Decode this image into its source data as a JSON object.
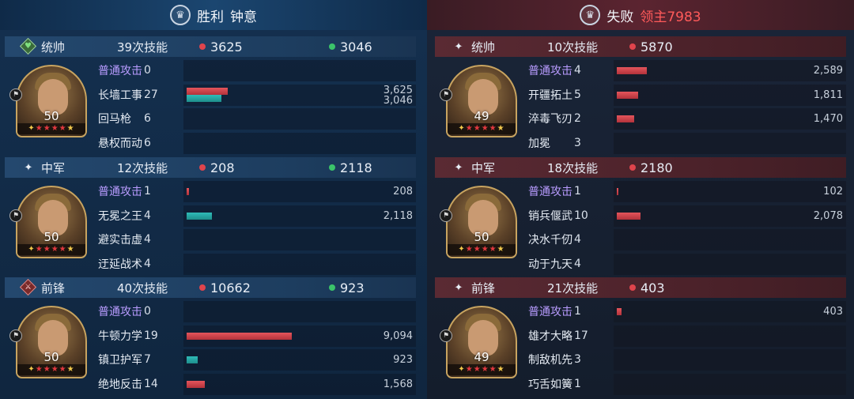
{
  "left": {
    "result": "胜利",
    "player": "钟意",
    "sections": [
      {
        "role": "统帅",
        "role_icon": "heart-icon",
        "casts": "39次技能",
        "damage": "3625",
        "heal": "3046",
        "level": "50",
        "skills": [
          {
            "name": "普通攻击",
            "count": "0",
            "basic": true
          },
          {
            "name": "长墙工事",
            "count": "27",
            "dmg": "3,625",
            "heal": "3,046",
            "dmg_pct": 0.18,
            "heal_pct": 0.15
          },
          {
            "name": "回马枪",
            "count": "6"
          },
          {
            "name": "悬权而动",
            "count": "6"
          }
        ]
      },
      {
        "role": "中军",
        "role_icon": "sparkle-icon",
        "casts": "12次技能",
        "damage": "208",
        "heal": "2118",
        "level": "50",
        "skills": [
          {
            "name": "普通攻击",
            "count": "1",
            "basic": true,
            "dmg": "208",
            "dmg_pct": 0.012
          },
          {
            "name": "无冕之王",
            "count": "4",
            "heal": "2,118",
            "heal_pct": 0.11
          },
          {
            "name": "避实击虚",
            "count": "4"
          },
          {
            "name": "迂延战术",
            "count": "4"
          }
        ]
      },
      {
        "role": "前锋",
        "role_icon": "sword-icon",
        "casts": "40次技能",
        "damage": "10662",
        "heal": "923",
        "level": "50",
        "skills": [
          {
            "name": "普通攻击",
            "count": "0",
            "basic": true
          },
          {
            "name": "牛顿力学",
            "count": "19",
            "dmg": "9,094",
            "dmg_pct": 0.46
          },
          {
            "name": "镇卫护军",
            "count": "7",
            "heal": "923",
            "heal_pct": 0.047
          },
          {
            "name": "绝地反击",
            "count": "14",
            "dmg": "1,568",
            "dmg_pct": 0.08
          }
        ]
      }
    ]
  },
  "right": {
    "result": "失败",
    "player": "领主7983",
    "sections": [
      {
        "role": "统帅",
        "role_icon": "sparkle-icon",
        "casts": "10次技能",
        "damage": "5870",
        "level": "49",
        "skills": [
          {
            "name": "普通攻击",
            "count": "4",
            "basic": true,
            "dmg": "2,589",
            "dmg_pct": 0.13
          },
          {
            "name": "开疆拓土",
            "count": "5",
            "dmg": "1,811",
            "dmg_pct": 0.092
          },
          {
            "name": "淬毒飞刃",
            "count": "2",
            "dmg": "1,470",
            "dmg_pct": 0.075
          },
          {
            "name": "加冕",
            "count": "3"
          }
        ]
      },
      {
        "role": "中军",
        "role_icon": "sparkle-icon",
        "casts": "18次技能",
        "damage": "2180",
        "level": "50",
        "skills": [
          {
            "name": "普通攻击",
            "count": "1",
            "basic": true,
            "dmg": "102",
            "dmg_pct": 0.005
          },
          {
            "name": "销兵偃武",
            "count": "10",
            "dmg": "2,078",
            "dmg_pct": 0.105
          },
          {
            "name": "决水千仞",
            "count": "4"
          },
          {
            "name": "动于九天",
            "count": "4"
          }
        ]
      },
      {
        "role": "前锋",
        "role_icon": "sparkle-icon",
        "casts": "21次技能",
        "damage": "403",
        "level": "49",
        "skills": [
          {
            "name": "普通攻击",
            "count": "1",
            "basic": true,
            "dmg": "403",
            "dmg_pct": 0.02
          },
          {
            "name": "雄才大略",
            "count": "17"
          },
          {
            "name": "制敌机先",
            "count": "3"
          },
          {
            "name": "巧舌如簧",
            "count": "1"
          }
        ]
      }
    ]
  }
}
